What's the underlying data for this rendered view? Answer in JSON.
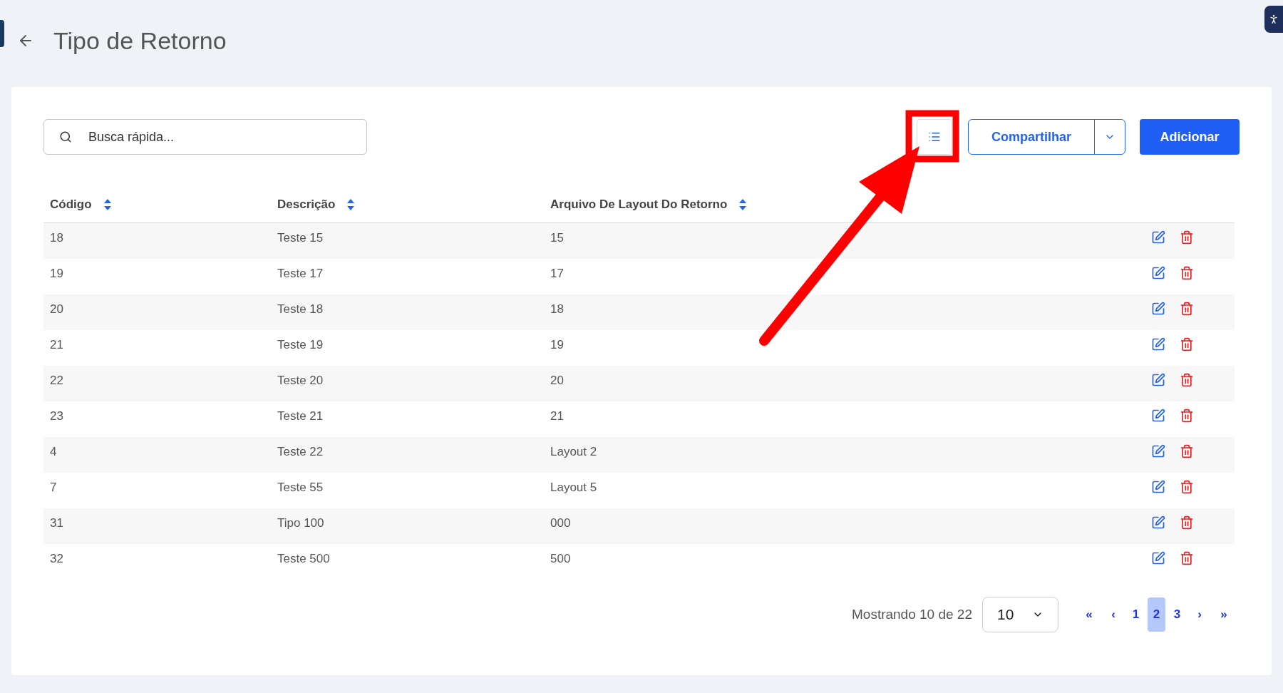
{
  "page": {
    "title": "Tipo de Retorno"
  },
  "toolbar": {
    "search": {
      "placeholder": "Busca rápida..."
    },
    "share_button": "Compartilhar",
    "add_button": "Adicionar"
  },
  "table": {
    "columns": [
      "Código",
      "Descrição",
      "Arquivo De Layout Do Retorno"
    ],
    "rows": [
      {
        "cells": [
          "18",
          "Teste 15",
          "15"
        ]
      },
      {
        "cells": [
          "19",
          "Teste 17",
          "17"
        ]
      },
      {
        "cells": [
          "20",
          "Teste 18",
          "18"
        ]
      },
      {
        "cells": [
          "21",
          "Teste 19",
          "19"
        ]
      },
      {
        "cells": [
          "22",
          "Teste 20",
          "20"
        ]
      },
      {
        "cells": [
          "23",
          "Teste 21",
          "21"
        ]
      },
      {
        "cells": [
          "4",
          "Teste 22",
          "Layout 2"
        ]
      },
      {
        "cells": [
          "7",
          "Teste 55",
          "Layout 5"
        ]
      },
      {
        "cells": [
          "31",
          "Tipo 100",
          "000"
        ]
      },
      {
        "cells": [
          "32",
          "Teste 500",
          "500"
        ]
      }
    ]
  },
  "pagination": {
    "summary": "Mostrando 10 de 22",
    "page_size": "10",
    "first": "«",
    "prev": "‹",
    "next": "›",
    "last": "»",
    "pages": [
      {
        "label": "1",
        "selected": false
      },
      {
        "label": "2",
        "selected": true
      },
      {
        "label": "3",
        "selected": false
      }
    ]
  }
}
